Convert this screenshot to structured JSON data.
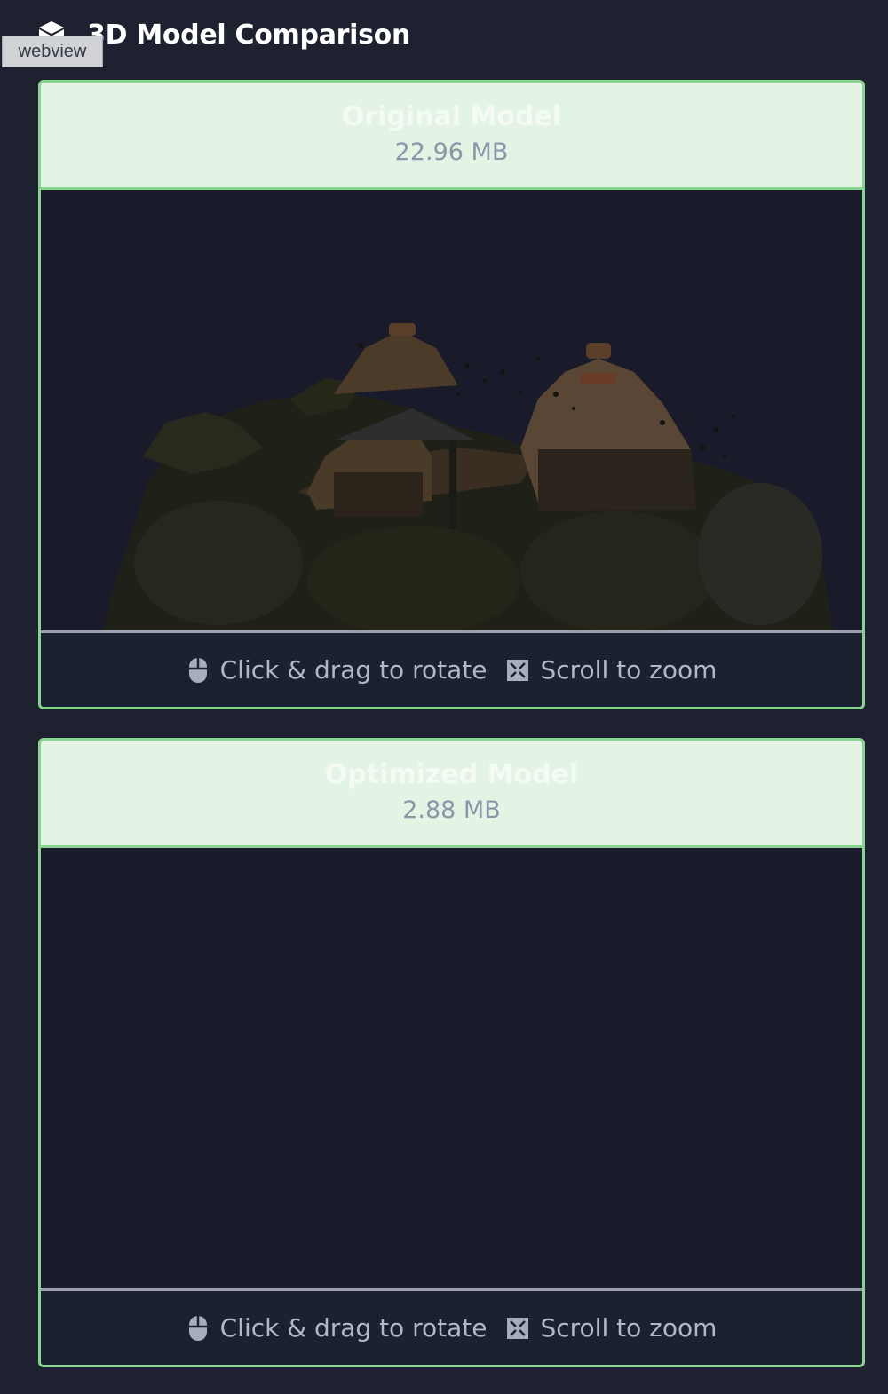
{
  "header": {
    "title": "3D Model Comparison",
    "icon": "cube-icon"
  },
  "overlay": {
    "label": "webview"
  },
  "models": [
    {
      "title": "Original Model",
      "size": "22.96 MB",
      "hint_rotate": "Click & drag to rotate",
      "hint_zoom": "Scroll to zoom",
      "loaded": true
    },
    {
      "title": "Optimized Model",
      "size": "2.88 MB",
      "hint_rotate": "Click & drag to rotate",
      "hint_zoom": "Scroll to zoom",
      "loaded": false
    }
  ],
  "colors": {
    "accent": "#86d48d",
    "background": "#1e2230",
    "viewport": "#191a2a",
    "header_band": "#e3f4e5"
  }
}
